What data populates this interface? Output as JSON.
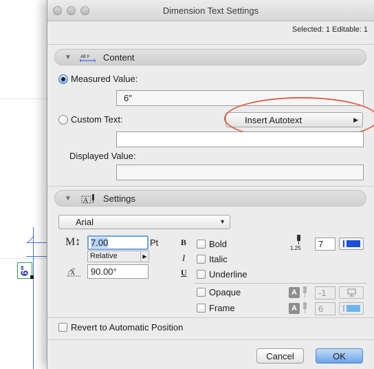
{
  "window": {
    "title": "Dimension Text Settings",
    "selected_info": "Selected: 1 Editable: 1"
  },
  "background": {
    "dimension_value": "6\""
  },
  "content_section": {
    "title": "Content",
    "icon_text": "AB t²",
    "measured_value_label": "Measured Value:",
    "measured_value": "6\"",
    "measured_selected": true,
    "custom_text_label": "Custom Text:",
    "custom_text_value": "",
    "insert_autotext_label": "Insert Autotext",
    "displayed_value_label": "Displayed Value:",
    "displayed_value": ""
  },
  "settings_section": {
    "title": "Settings",
    "font": "Arial",
    "size_value": "7.00",
    "size_unit": "Pt",
    "size_mode": "Relative",
    "angle_value": "90.00°",
    "bold_label": "Bold",
    "italic_label": "Italic",
    "underline_label": "Underline",
    "bold_glyph": "B",
    "italic_glyph": "I",
    "underline_glyph": "U",
    "pen_scale_label": "1.25",
    "pen_number": "7",
    "pen_color": "#1a4fd8",
    "opaque_label": "Opaque",
    "opaque_pen": "-1",
    "frame_label": "Frame",
    "frame_pen": "6",
    "frame_pen_color": "#4aa8e8"
  },
  "revert_label": "Revert to Automatic Position",
  "buttons": {
    "cancel": "Cancel",
    "ok": "OK"
  },
  "colors": {
    "accent": "#6aa3ea",
    "highlight": "#e15d45",
    "dimension_line": "#4a6fd8"
  }
}
